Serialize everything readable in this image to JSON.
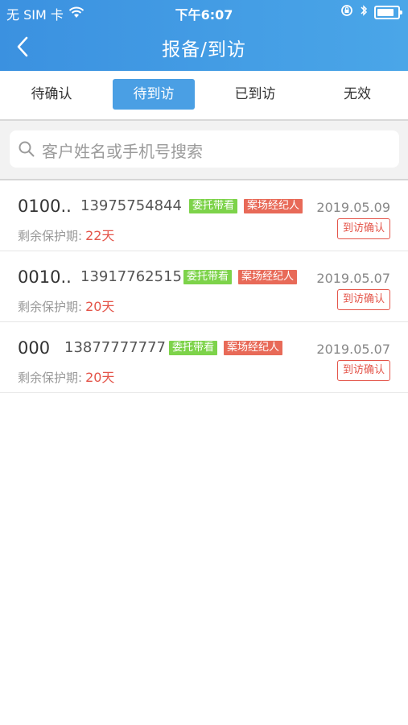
{
  "status_bar": {
    "carrier": "无 SIM 卡",
    "time": "下午6:07",
    "icons": [
      "wifi-icon",
      "orientation-lock-icon",
      "bluetooth-icon",
      "battery-icon"
    ]
  },
  "nav": {
    "title": "报备/到访",
    "back_icon": "chevron-left-icon"
  },
  "tabs": [
    {
      "label": "待确认",
      "active": false
    },
    {
      "label": "待到访",
      "active": true
    },
    {
      "label": "已到访",
      "active": false
    },
    {
      "label": "无效",
      "active": false
    }
  ],
  "search": {
    "placeholder": "客户姓名或手机号搜索",
    "icon": "search-icon"
  },
  "records": [
    {
      "name": "0100..",
      "phone": "13975754844",
      "tags": [
        "委托带看",
        "案场经纪人"
      ],
      "date": "2019.05.09",
      "protect_label": "剩余保护期:",
      "protect_days": "22天",
      "action": "到访确认"
    },
    {
      "name": "0010..",
      "phone": "13917762515",
      "tags": [
        "委托带看",
        "案场经纪人"
      ],
      "date": "2019.05.07",
      "protect_label": "剩余保护期:",
      "protect_days": "20天",
      "action": "到访确认"
    },
    {
      "name": "000",
      "phone": "13877777777",
      "tags": [
        "委托带看",
        "案场经纪人"
      ],
      "date": "2019.05.07",
      "protect_label": "剩余保护期:",
      "protect_days": "20天",
      "action": "到访确认"
    }
  ],
  "colors": {
    "header": "#3b91e0",
    "active_tab": "#4a9fe4",
    "tag_green": "#7dd34a",
    "tag_red": "#e86a58",
    "accent_red": "#e4554a"
  }
}
